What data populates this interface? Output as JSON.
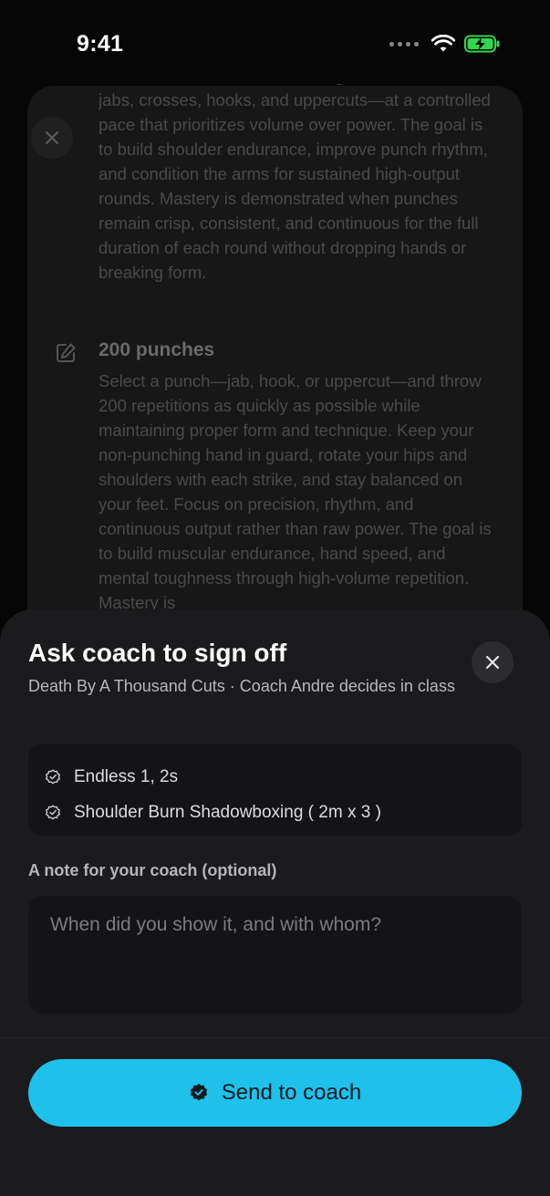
{
  "status_bar": {
    "time": "9:41"
  },
  "background_card": {
    "paragraph1": "Throw continuous shadowboxing combinations—jabs, crosses, hooks, and uppercuts—at a controlled pace that prioritizes volume over power. The goal is to build shoulder endurance, improve punch rhythm, and condition the arms for sustained high-output rounds. Mastery is demonstrated when punches remain crisp, consistent, and continuous for the full duration of each round without dropping hands or breaking form.",
    "skill_title": "200 punches",
    "paragraph2": "Select a punch—jab, hook, or uppercut—and throw 200 repetitions as quickly as possible while maintaining proper form and technique. Keep your non-punching hand in guard, rotate your hips and shoulders with each strike, and stay balanced on your feet. Focus on precision, rhythm, and continuous output rather than raw power. The goal is to build muscular endurance, hand speed, and mental toughness through high-volume repetition. Mastery is"
  },
  "sheet": {
    "title": "Ask coach to sign off",
    "subtitle": "Death By A Thousand Cuts · Coach Andre decides in class",
    "skills": [
      {
        "label": "Endless 1, 2s",
        "icon": "verified-badge-icon"
      },
      {
        "label": "Shoulder Burn Shadowboxing ( 2m x 3 )",
        "icon": "verified-badge-icon"
      }
    ],
    "note_label": "A note for your coach (optional)",
    "note_placeholder": "When did you show it, and with whom?",
    "note_value": "",
    "send_label": "Send to coach"
  },
  "colors": {
    "accent": "#1ec1ea",
    "sheet_bg": "#1b1b1d",
    "battery_green": "#32d74b"
  }
}
